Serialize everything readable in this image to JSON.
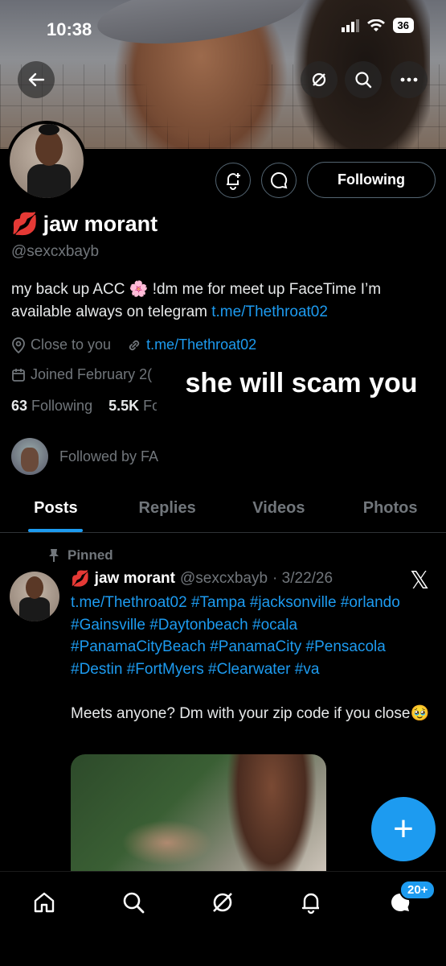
{
  "status_bar": {
    "time": "10:38",
    "battery": "36"
  },
  "profile": {
    "display_name": "jaw morant",
    "name_emoji": "💋",
    "handle": "@sexcxbayb",
    "bio_text": "my back up ACC 🌸 !dm me for meet up FaceTime I’m available always on telegram ",
    "bio_link": "t.me/Thethroat02",
    "location": "Close to you",
    "website": "t.me/Thethroat02",
    "joined": "Joined February 2(",
    "following_count": "63",
    "following_label": "Following",
    "followers_count": "5.5K",
    "followers_label": "Fo",
    "followed_by": "Followed by FA",
    "follow_button": "Following"
  },
  "overlay_caption": "she will scam you",
  "tabs": [
    "Posts",
    "Replies",
    "Videos",
    "Photos"
  ],
  "pinned_post": {
    "pinned_label": "Pinned",
    "name": "jaw morant",
    "handle": "@sexcxbayb",
    "date": "· 3/22/26",
    "link": "t.me/Thethroat02",
    "hashtags": "#Tampa #jacksonville #orlando #Gainsville #Daytonbeach #ocala #PanamaCityBeach #PanamaCity #Pensacola #Destin #FortMyers #Clearwater #va",
    "text": "Meets anyone? Dm with your zip code if you close",
    "text_emoji": "🥹"
  },
  "fab_label": "+",
  "nav": {
    "messages_badge": "20+"
  },
  "colors": {
    "accent": "#1d9bf0",
    "background": "#000000",
    "secondary_text": "#71767b"
  },
  "icons": [
    "back-arrow-icon",
    "grok-icon",
    "search-icon",
    "more-icon",
    "notification-bell-plus-icon",
    "message-icon",
    "location-pin-icon",
    "link-icon",
    "calendar-icon",
    "pin-icon",
    "x-logo-icon",
    "home-icon",
    "search-icon",
    "grok-icon",
    "bell-icon",
    "messages-icon"
  ]
}
